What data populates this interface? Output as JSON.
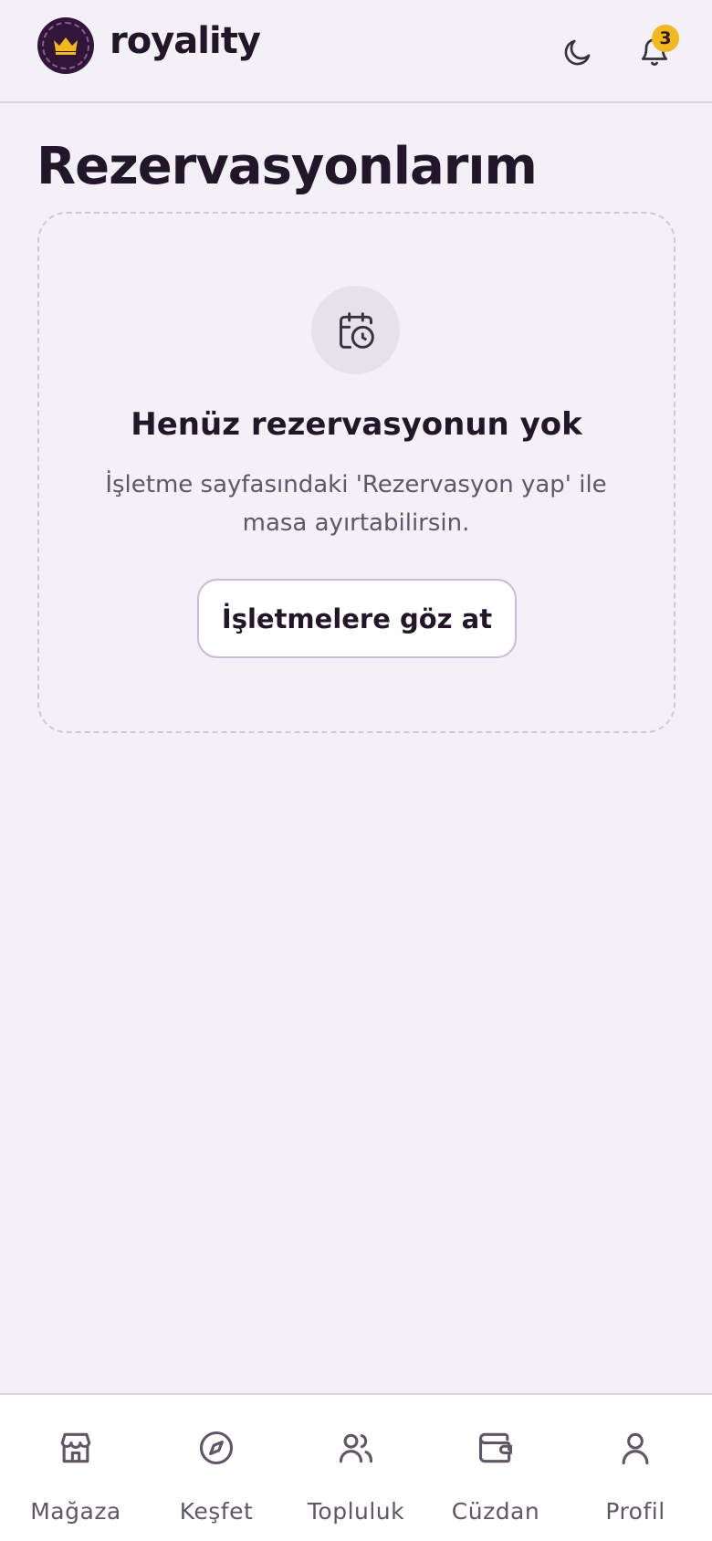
{
  "header": {
    "brand": "royality",
    "notification_count": "3",
    "logo_icon": "crown-icon",
    "theme_icon": "moon-icon",
    "notifications_icon": "bell-icon"
  },
  "page": {
    "title": "Rezervasyonlarım"
  },
  "empty_state": {
    "icon": "calendar-clock-icon",
    "title": "Henüz rezervasyonun yok",
    "description": "İşletme sayfasındaki 'Rezervasyon yap' ile masa ayırtabilirsin.",
    "button_label": "İşletmelere göz at"
  },
  "bottom_nav": {
    "items": [
      {
        "label": "Mağaza",
        "icon": "store-icon"
      },
      {
        "label": "Keşfet",
        "icon": "compass-icon"
      },
      {
        "label": "Topluluk",
        "icon": "users-icon"
      },
      {
        "label": "Cüzdan",
        "icon": "wallet-icon"
      },
      {
        "label": "Profil",
        "icon": "user-icon"
      }
    ]
  },
  "colors": {
    "background": "#f3f1f7",
    "brand_dark": "#32163a",
    "badge": "#f2b81f",
    "text_primary": "#221629",
    "text_secondary": "#5f5666"
  }
}
